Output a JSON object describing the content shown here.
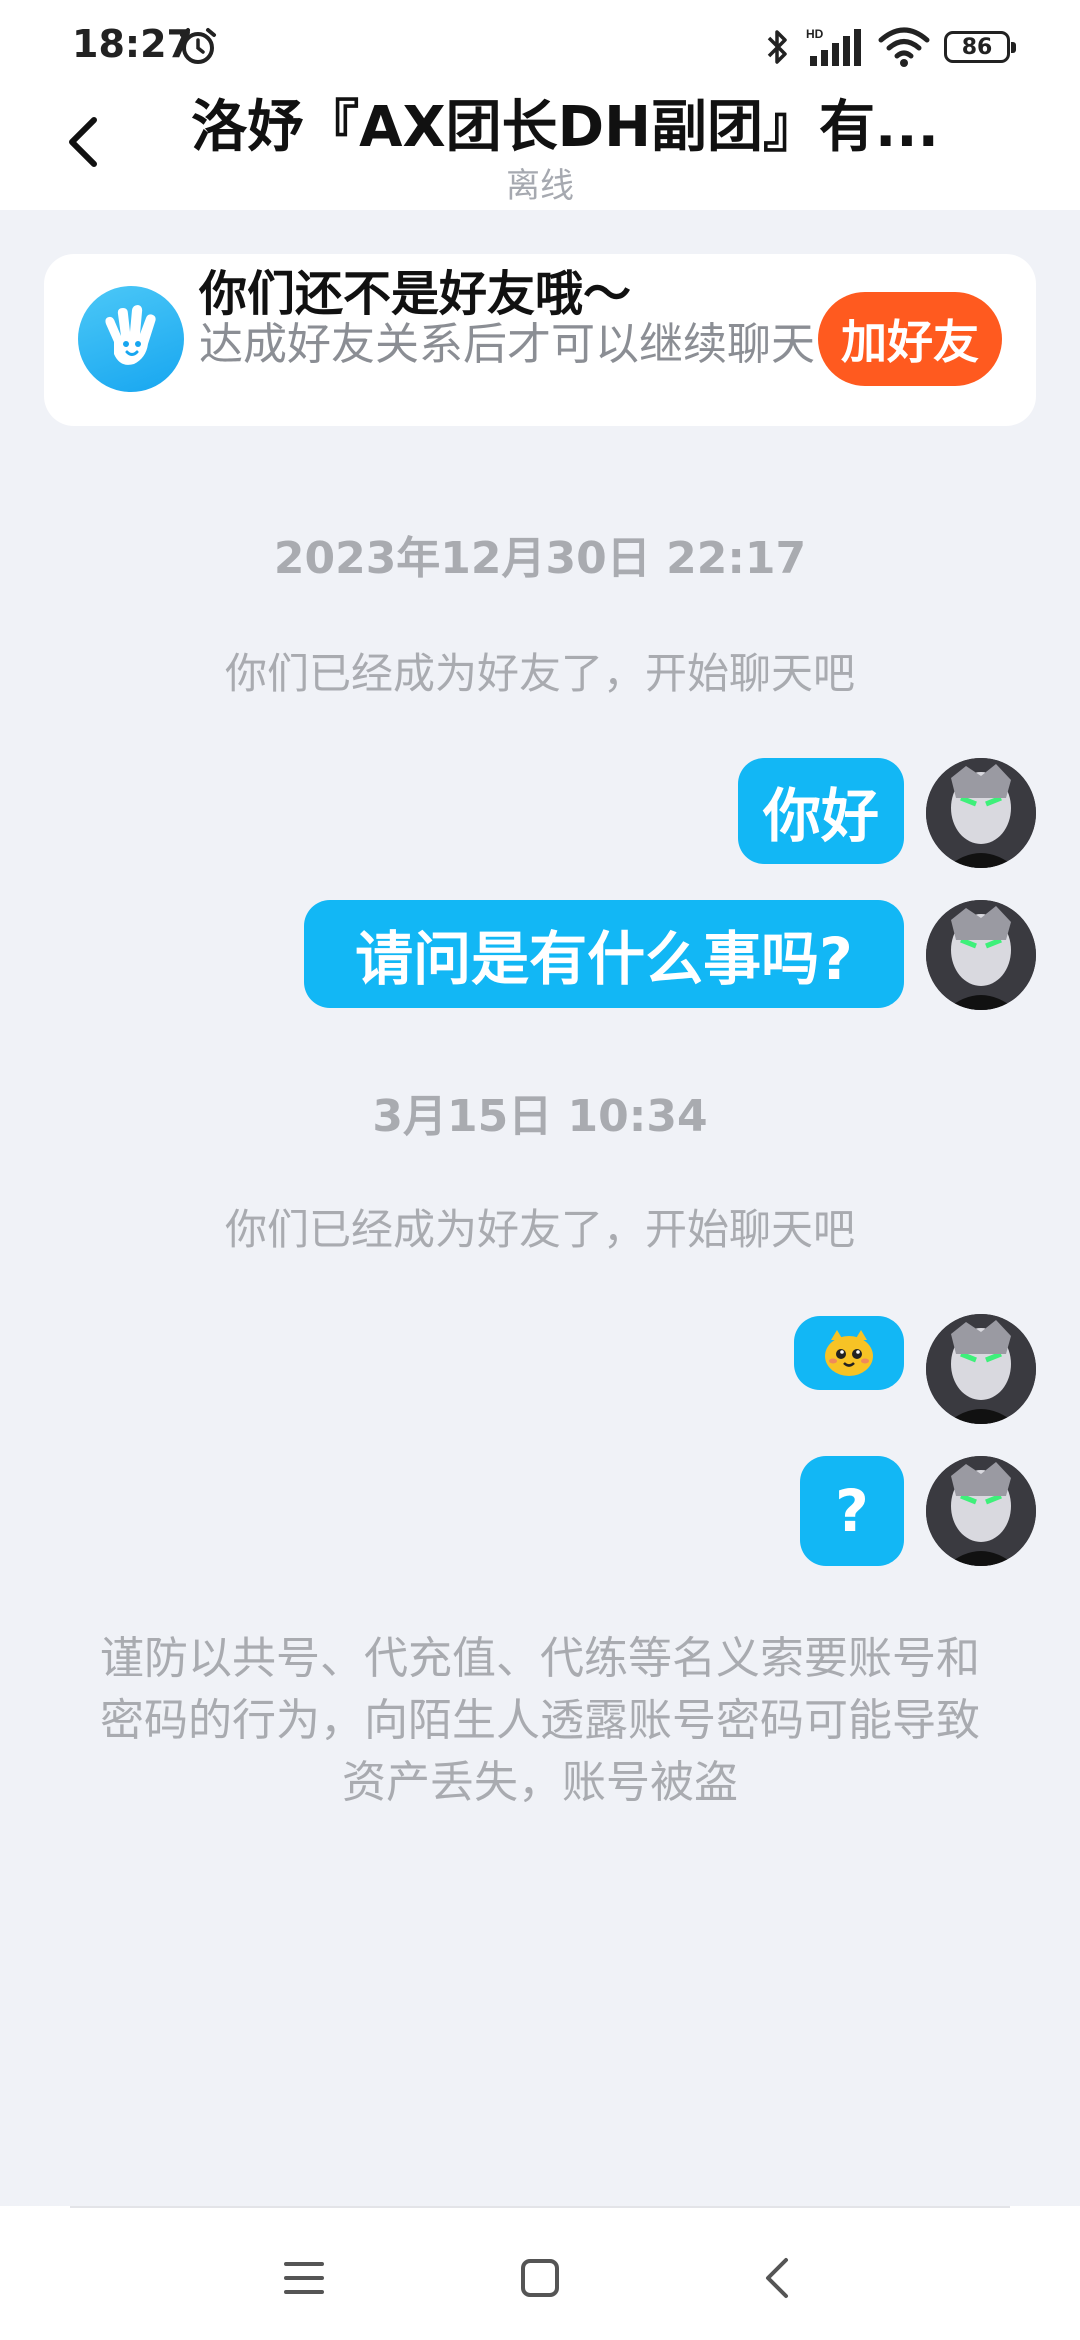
{
  "status_bar": {
    "time": "18:27",
    "battery": "86",
    "hd_label": "HD"
  },
  "header": {
    "title": "洛妤『AX团长DH副团』有...",
    "subtitle": "离线"
  },
  "banner": {
    "title": "你们还不是好友哦～",
    "description": "达成好友关系后才可以继续聊天",
    "button_label": "加好友"
  },
  "messages": {
    "time_1": "2023年12月30日 22:17",
    "note_1": "你们已经成为好友了，开始聊天吧",
    "msg_1": "你好",
    "msg_2": "请问是有什么事吗?",
    "time_2": "3月15日 10:34",
    "note_2": "你们已经成为好友了，开始聊天吧",
    "msg_3_emoji": "yellow-face-emoji",
    "msg_4": "?"
  },
  "warning": "谨防以共号、代充值、代练等名义索要账号和密码的行为，向陌生人透露账号密码可能导致资产丢失，账号被盗",
  "colors": {
    "accent_blue": "#12b7f5",
    "add_friend_orange": "#ff5a1f",
    "background": "#f0f2f7"
  }
}
